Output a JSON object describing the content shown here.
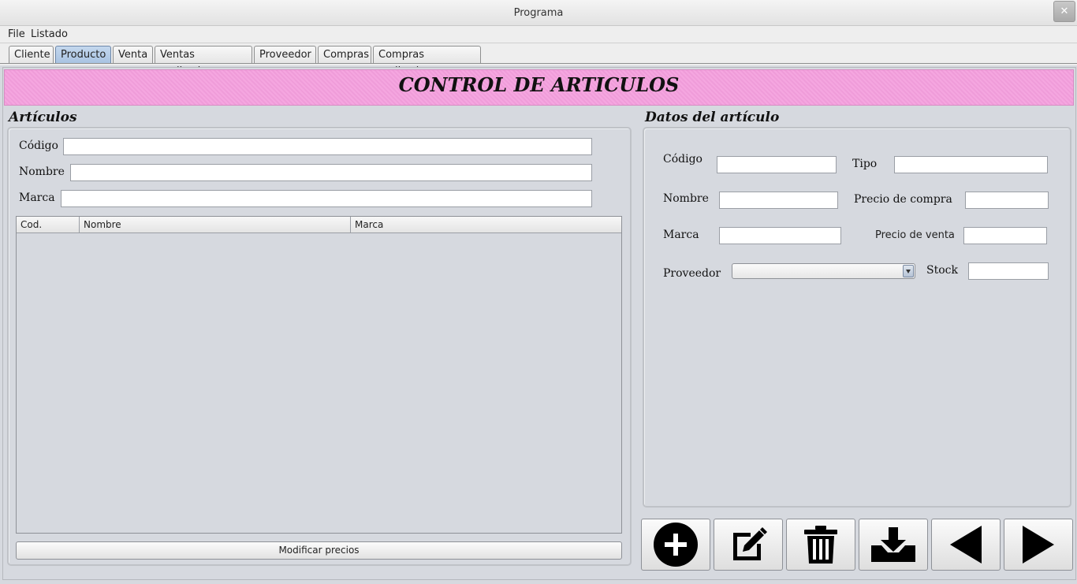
{
  "window": {
    "title": "Programa",
    "close_glyph": "✕"
  },
  "menu": {
    "items": [
      "File",
      "Listado"
    ]
  },
  "tabs": [
    {
      "label": "Cliente"
    },
    {
      "label": "Producto",
      "active": true
    },
    {
      "label": "Venta"
    },
    {
      "label": "Ventas realizadas"
    },
    {
      "label": "Proveedor"
    },
    {
      "label": "Compras"
    },
    {
      "label": "Compras realizadas"
    }
  ],
  "banner": {
    "title": "CONTROL DE ARTICULOS",
    "color": "#f49fdd"
  },
  "articulos": {
    "title": "Artículos",
    "filters": {
      "codigo_label": "Código",
      "codigo_value": "",
      "nombre_label": "Nombre",
      "nombre_value": "",
      "marca_label": "Marca",
      "marca_value": ""
    },
    "table": {
      "columns": [
        "Cod.",
        "Nombre",
        "Marca"
      ],
      "rows": []
    },
    "modify_prices_label": "Modificar precios"
  },
  "datos": {
    "title": "Datos del artículo",
    "codigo_label": "Código",
    "codigo_value": "",
    "tipo_label": "Tipo",
    "tipo_value": "",
    "nombre_label": "Nombre",
    "nombre_value": "",
    "precio_compra_label": "Precio de compra",
    "precio_compra_value": "",
    "marca_label": "Marca",
    "marca_value": "",
    "precio_venta_label": "Precio de venta",
    "precio_venta_value": "",
    "proveedor_label": "Proveedor",
    "proveedor_selected": "",
    "stock_label": "Stock",
    "stock_value": ""
  },
  "toolbar": {
    "buttons": [
      {
        "icon": "add-circle-icon"
      },
      {
        "icon": "edit-icon"
      },
      {
        "icon": "trash-icon"
      },
      {
        "icon": "download-tray-icon"
      },
      {
        "icon": "arrow-left-icon"
      },
      {
        "icon": "arrow-right-icon"
      }
    ]
  }
}
